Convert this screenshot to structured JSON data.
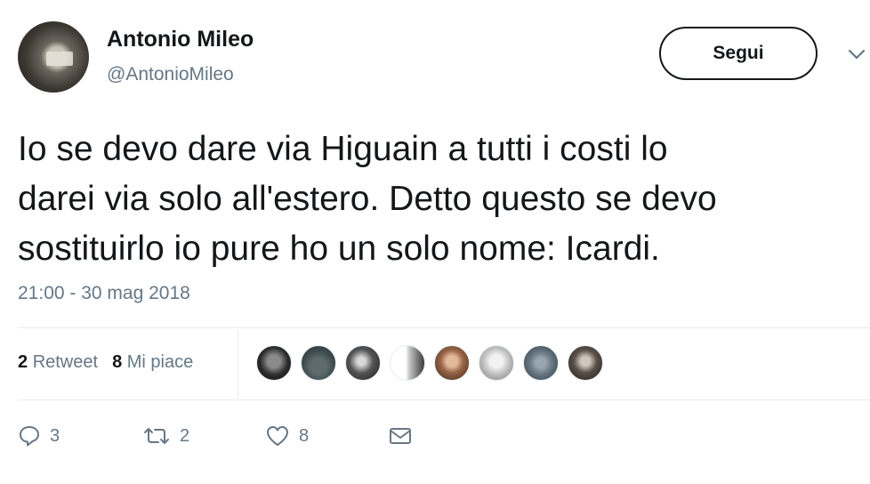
{
  "user": {
    "display_name": "Antonio Mileo",
    "handle": "@AntonioMileo"
  },
  "follow_button": {
    "label": "Segui"
  },
  "menu": {
    "icon": "chevron-down-icon"
  },
  "tweet": {
    "lines": [
      "Io se devo dare via Higuain a tutti i costi lo",
      "darei via solo all'estero. Detto questo se devo",
      "sostituirlo io pure ho un solo nome: Icardi."
    ],
    "timestamp": "21:00 - 30 mag 2018"
  },
  "stats": {
    "retweet_count": "2",
    "retweet_label": "Retweet",
    "like_count": "8",
    "like_label": "Mi piace"
  },
  "likers": [
    {
      "icon": "avatar"
    },
    {
      "icon": "avatar"
    },
    {
      "icon": "avatar"
    },
    {
      "icon": "avatar"
    },
    {
      "icon": "avatar"
    },
    {
      "icon": "avatar"
    },
    {
      "icon": "avatar"
    },
    {
      "icon": "avatar"
    }
  ],
  "actions": {
    "reply": {
      "icon": "reply-icon",
      "count": "3"
    },
    "retweet": {
      "icon": "retweet-icon",
      "count": "2"
    },
    "like": {
      "icon": "heart-icon",
      "count": "8"
    },
    "message": {
      "icon": "mail-icon"
    }
  },
  "colors": {
    "text": "#14171a",
    "secondary": "#657786",
    "divider": "#e6ecf0"
  }
}
